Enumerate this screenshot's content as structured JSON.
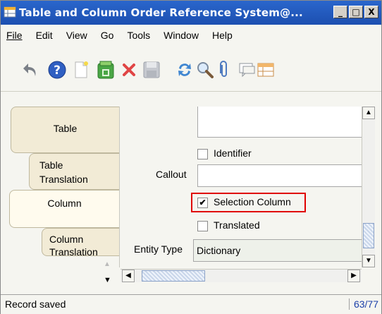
{
  "window": {
    "title": "Table and Column Order Reference System@...",
    "minimize": "_",
    "maximize": "□",
    "close": "X"
  },
  "menu": {
    "file": "File",
    "edit": "Edit",
    "view": "View",
    "go": "Go",
    "tools": "Tools",
    "window": "Window",
    "help": "Help"
  },
  "toolbar": {
    "icons": [
      "undo-icon",
      "help-icon",
      "new-record-icon",
      "copy-icon",
      "delete-icon",
      "save-icon",
      "refresh-icon",
      "find-icon",
      "attachment-icon",
      "chat-icon",
      "grid-toggle-icon"
    ]
  },
  "tabs": {
    "table": "Table",
    "table_translation": "Table Translation",
    "column": "Column",
    "column_translation": "Column Translation"
  },
  "form": {
    "identifier_label": "Identifier",
    "identifier_checked": false,
    "callout_label": "Callout",
    "callout_value": "",
    "selection_column_label": "Selection Column",
    "selection_column_checked": true,
    "selection_mark": "✔",
    "translated_label": "Translated",
    "translated_checked": false,
    "entity_type_label": "Entity Type",
    "entity_type_value": "Dictionary"
  },
  "status": {
    "message": "Record saved",
    "record_count": "63/77"
  },
  "colors": {
    "titlebar": "#1c4fb0",
    "highlight": "#e00000",
    "tab_bg": "#f2ebd6"
  }
}
